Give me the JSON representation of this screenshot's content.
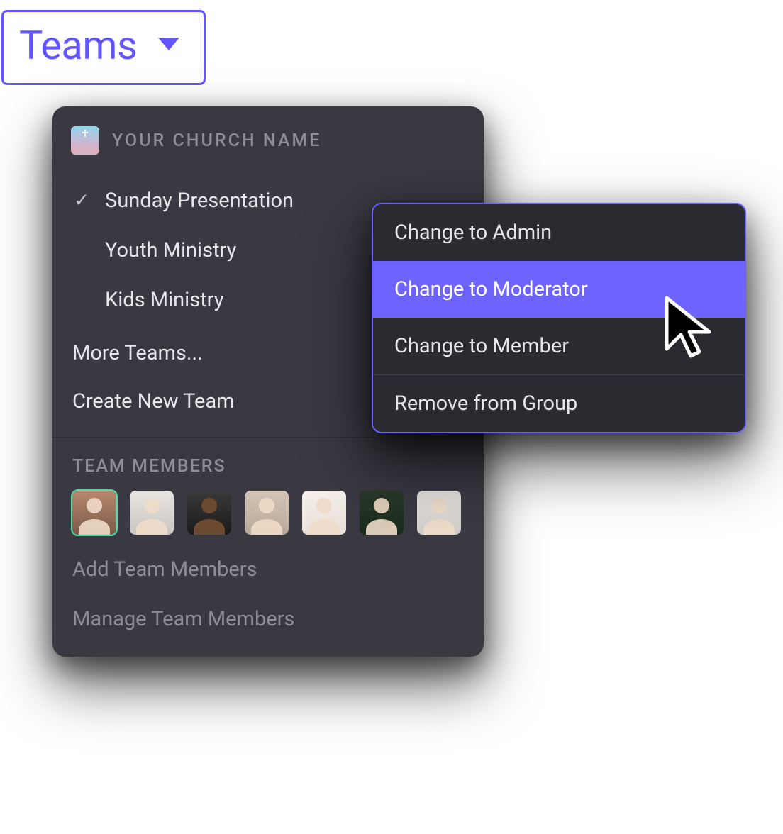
{
  "dropdown": {
    "label": "Teams"
  },
  "panel": {
    "church_name": "YOUR CHURCH NAME",
    "teams": [
      {
        "label": "Sunday Presentation",
        "selected": true
      },
      {
        "label": "Youth Ministry",
        "selected": false
      },
      {
        "label": "Kids Ministry",
        "selected": false
      }
    ],
    "more_label": "More Teams...",
    "create_label": "Create New Team",
    "members_header": "TEAM MEMBERS",
    "add_label": "Add Team Members",
    "manage_label": "Manage Team Members"
  },
  "context_menu": {
    "items": [
      {
        "label": "Change to Admin"
      },
      {
        "label": "Change to Moderator",
        "highlighted": true
      },
      {
        "label": "Change to Member"
      }
    ],
    "remove_label": "Remove from Group"
  }
}
